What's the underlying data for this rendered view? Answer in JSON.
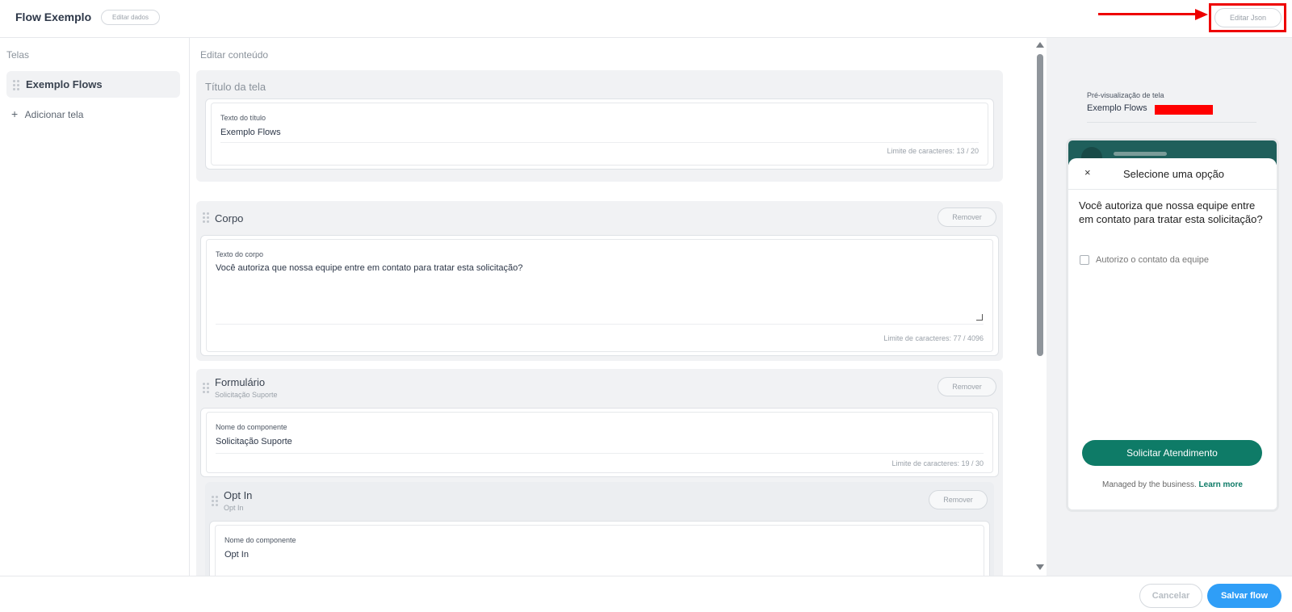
{
  "header": {
    "flow_title": "Flow Exemplo",
    "edit_data_label": "Editar dados",
    "edit_json_label": "Editar Json",
    "accent": "#e00000"
  },
  "left": {
    "section_label": "Telas",
    "screens": [
      {
        "label": "Exemplo Flows"
      }
    ],
    "add_screen_label": "Adicionar tela"
  },
  "middle": {
    "section_label": "Editar conteúdo",
    "title_card": {
      "heading": "Título da tela",
      "field_label": "Texto do título",
      "field_value": "Exemplo Flows",
      "limit": "Limite de caracteres: 13 / 20"
    },
    "body_card": {
      "heading": "Corpo",
      "remove_label": "Remover",
      "field_label": "Texto do corpo",
      "field_value": "Você autoriza que nossa equipe entre em contato para tratar esta solicitação?",
      "limit": "Limite de caracteres: 77 / 4096"
    },
    "form_card": {
      "heading": "Formulário",
      "subheading": "Solicitação Suporte",
      "remove_label": "Remover",
      "field_label": "Nome do componente",
      "field_value": "Solicitação Suporte",
      "limit": "Limite de caracteres: 19 / 30",
      "optin": {
        "heading": "Opt In",
        "subheading": "Opt In",
        "remove_label": "Remover",
        "field_label": "Nome do componente",
        "field_value": "Opt In"
      }
    }
  },
  "preview": {
    "label": "Pré-visualização de tela",
    "screen_name": "Exemplo Flows",
    "sheet_title": "Selecione uma opção",
    "close_icon": "×",
    "body": "Você autoriza que nossa equipe entre em contato para tratar esta solicitação?",
    "checkbox_label": "Autorizo o contato da equipe",
    "cta_label": "Solicitar Atendimento",
    "managed_text": "Managed by the business.",
    "learn_more": "Learn more",
    "brand_color": "#0e7b67"
  },
  "footer": {
    "cancel_label": "Cancelar",
    "save_label": "Salvar flow",
    "save_color": "#2f9ef7"
  },
  "icons": {
    "drag_handle": "drag-handle-icon",
    "add": "+",
    "close": "close-icon"
  }
}
